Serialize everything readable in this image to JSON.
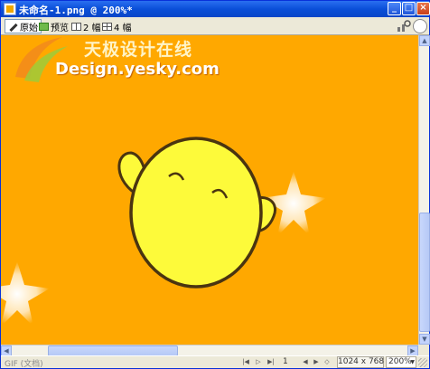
{
  "window": {
    "title": "未命名-1.png @ 200%*",
    "controls": [
      "minimize",
      "maximize",
      "close"
    ]
  },
  "toolbar": {
    "original_label": "原始",
    "preview_label": "预览",
    "two_up_label": "2 幅",
    "four_up_label": "4 幅"
  },
  "canvas": {
    "background_color": "#ffa800",
    "watermark_cn": "天极设计在线",
    "watermark_en": "Design.yesky.com",
    "character_color": "#fdfa3a",
    "outline_color": "#4a3410"
  },
  "status": {
    "format": "GIF (文档)",
    "frame_number": "1",
    "doc_size": "1024 x 768",
    "zoom": "200%"
  },
  "icons": {
    "original": "pencil-icon",
    "preview": "preview-icon",
    "two_up": "two-up-icon",
    "four_up": "four-up-icon"
  }
}
